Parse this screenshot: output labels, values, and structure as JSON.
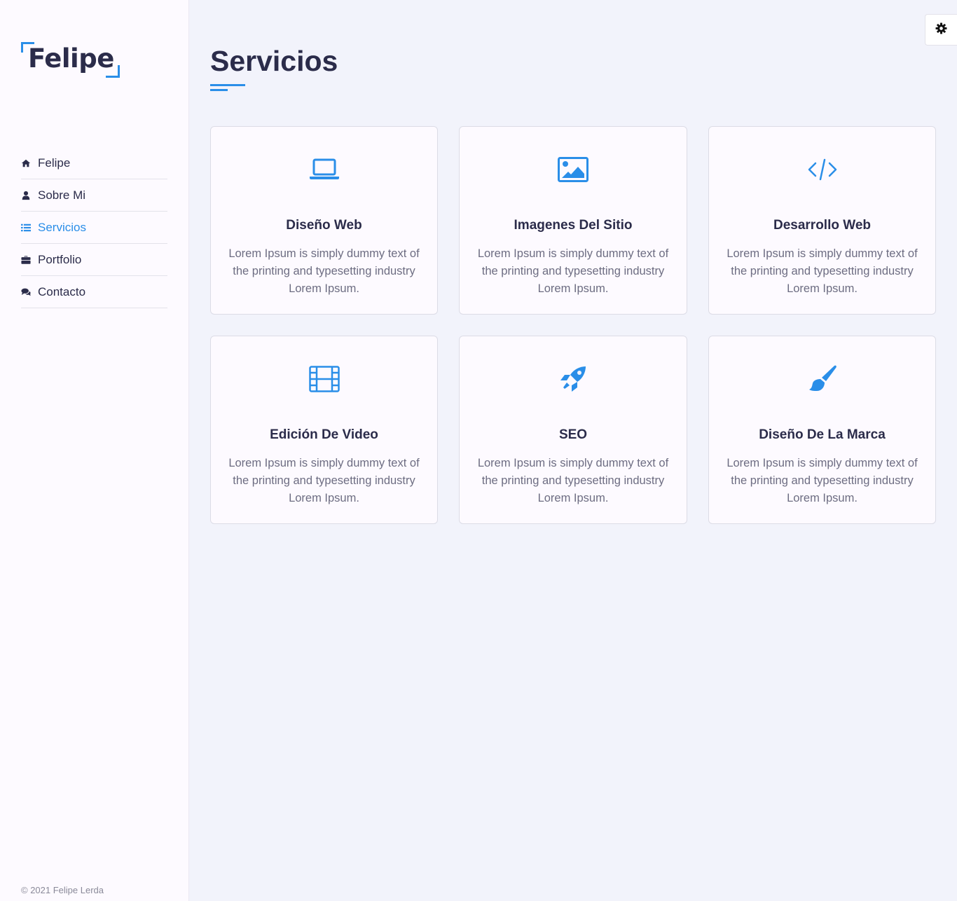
{
  "brand": {
    "logo_text": "Felipe"
  },
  "nav": {
    "items": [
      {
        "label": "Felipe",
        "icon": "home-icon",
        "active": false
      },
      {
        "label": "Sobre Mi",
        "icon": "user-icon",
        "active": false
      },
      {
        "label": "Servicios",
        "icon": "list-icon",
        "active": true
      },
      {
        "label": "Portfolio",
        "icon": "briefcase-icon",
        "active": false
      },
      {
        "label": "Contacto",
        "icon": "comments-icon",
        "active": false
      }
    ]
  },
  "footer": {
    "copyright": "© 2021 Felipe Lerda"
  },
  "settings": {
    "icon": "gear-icon"
  },
  "main": {
    "title": "Servicios",
    "services": [
      {
        "icon": "laptop-icon",
        "title": "Diseño Web",
        "description": "Lorem Ipsum is simply dummy text of the printing and typesetting industry Lorem Ipsum."
      },
      {
        "icon": "image-icon",
        "title": "Imagenes Del Sitio",
        "description": "Lorem Ipsum is simply dummy text of the printing and typesetting industry Lorem Ipsum."
      },
      {
        "icon": "code-icon",
        "title": "Desarrollo Web",
        "description": "Lorem Ipsum is simply dummy text of the printing and typesetting industry Lorem Ipsum."
      },
      {
        "icon": "film-icon",
        "title": "Edición De Video",
        "description": "Lorem Ipsum is simply dummy text of the printing and typesetting industry Lorem Ipsum."
      },
      {
        "icon": "rocket-icon",
        "title": "SEO",
        "description": "Lorem Ipsum is simply dummy text of the printing and typesetting industry Lorem Ipsum."
      },
      {
        "icon": "paint-brush-icon",
        "title": "Diseño De La Marca",
        "description": "Lorem Ipsum is simply dummy text of the printing and typesetting industry Lorem Ipsum."
      }
    ]
  },
  "colors": {
    "accent": "#2a8ee8",
    "text": "#2b2c4a",
    "background": "#f2f3fb",
    "sidebar": "#fdfaff"
  }
}
